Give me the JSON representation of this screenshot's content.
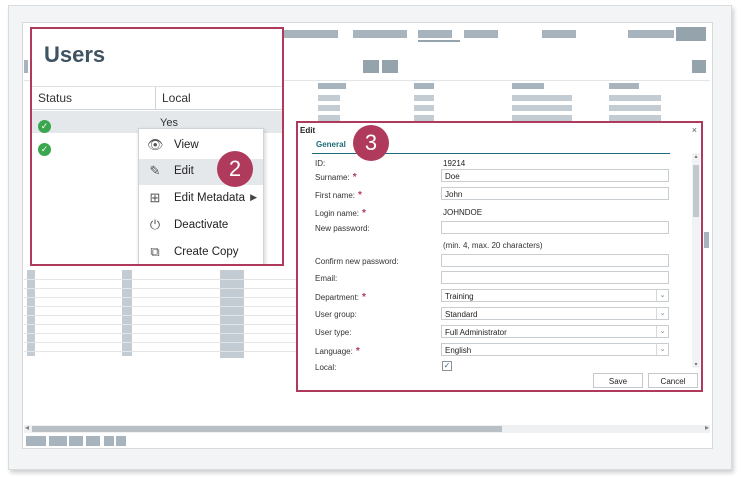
{
  "users": {
    "title": "Users",
    "columns": {
      "status": "Status",
      "local": "Local"
    },
    "row1_local": "Yes"
  },
  "context_menu": {
    "items": [
      {
        "label": "View",
        "icon": "eye-icon"
      },
      {
        "label": "Edit",
        "icon": "pencil-icon"
      },
      {
        "label": "Edit Metadata",
        "icon": "metadata-icon"
      },
      {
        "label": "Deactivate",
        "icon": "power-icon"
      },
      {
        "label": "Create Copy",
        "icon": "copy-icon"
      }
    ]
  },
  "badges": {
    "step2": "2",
    "step3": "3"
  },
  "edit_dialog": {
    "title": "Edit",
    "close": "×",
    "tab": "General",
    "fields": {
      "id": {
        "label": "ID:",
        "value": "19214"
      },
      "surname": {
        "label": "Surname:",
        "value": "Doe",
        "required": "*"
      },
      "first_name": {
        "label": "First name:",
        "value": "John",
        "required": "*"
      },
      "login_name": {
        "label": "Login name:",
        "value": "JOHNDOE",
        "required": "*"
      },
      "new_password": {
        "label": "New password:",
        "value": ""
      },
      "password_hint": "(min. 4, max. 20 characters)",
      "confirm_password": {
        "label": "Confirm new password:",
        "value": ""
      },
      "email": {
        "label": "Email:",
        "value": ""
      },
      "department": {
        "label": "Department:",
        "value": "Training",
        "required": "*"
      },
      "user_group": {
        "label": "User group:",
        "value": "Standard"
      },
      "user_type": {
        "label": "User type:",
        "value": "Full Administrator"
      },
      "language": {
        "label": "Language:",
        "value": "English",
        "required": "*"
      },
      "local": {
        "label": "Local:",
        "checked": true
      }
    },
    "buttons": {
      "save": "Save",
      "cancel": "Cancel"
    }
  },
  "colors": {
    "accent": "#b03a5b",
    "success": "#3aa64e",
    "tab": "#1f6a7a"
  }
}
